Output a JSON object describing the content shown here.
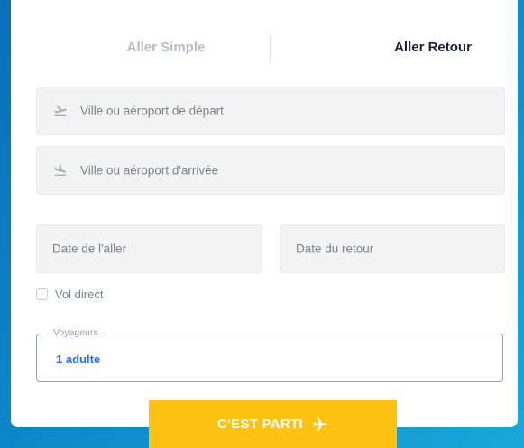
{
  "tabs": {
    "one_way": "Aller Simple",
    "round_trip": "Aller Retour"
  },
  "departure": {
    "placeholder": "Ville ou aéroport de départ",
    "icon": "plane-takeoff-icon"
  },
  "arrival": {
    "placeholder": "Ville ou aéroport d'arrivée",
    "icon": "plane-landing-icon"
  },
  "dates": {
    "outbound_placeholder": "Date de l'aller",
    "return_placeholder": "Date du retour"
  },
  "direct": {
    "label": "Vol direct",
    "checked": false
  },
  "travellers": {
    "legend": "Voyageurs",
    "value": "1 adulte"
  },
  "submit": {
    "label": "C'EST PARTI",
    "icon": "plane-icon"
  },
  "colors": {
    "accent": "#fec312",
    "link": "#2f6fea",
    "background_start": "#0a6fb8",
    "background_end": "#18a8d8"
  }
}
